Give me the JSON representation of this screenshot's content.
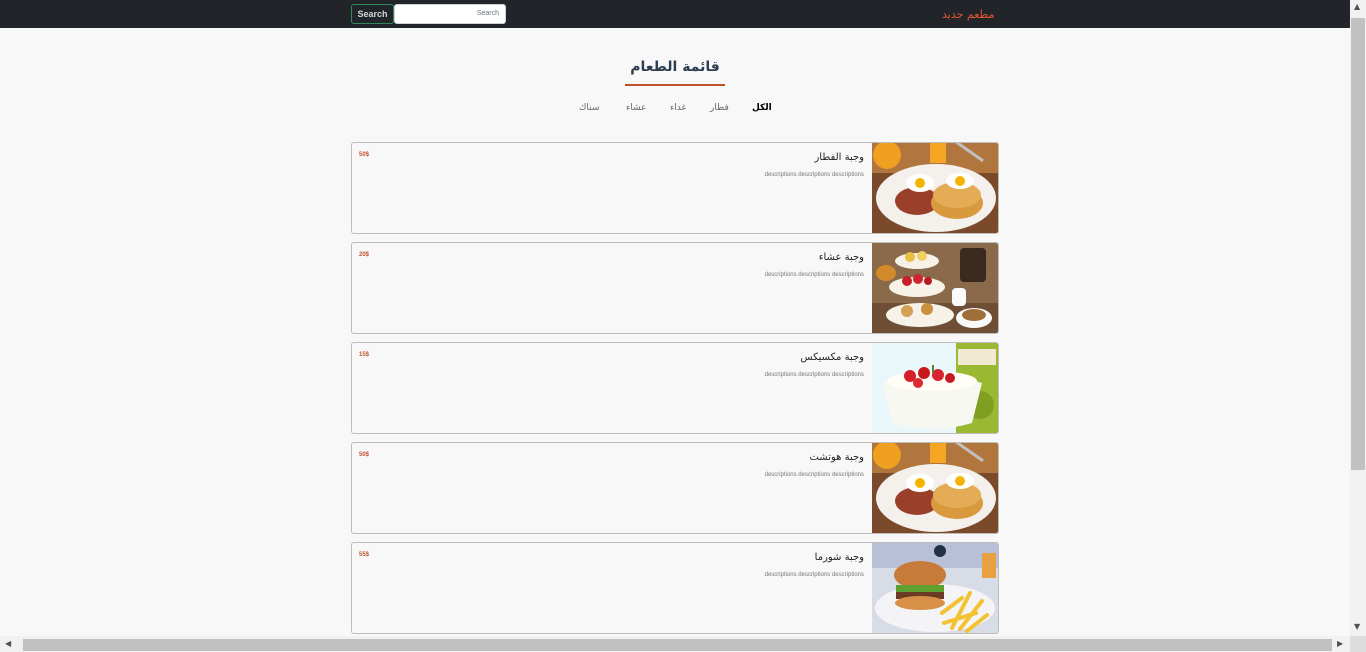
{
  "navbar": {
    "brand": "مطعم جديد",
    "search_button": "Search",
    "search_placeholder": "Search"
  },
  "menu": {
    "title": "قائمة الطعام",
    "tabs": [
      "الكل",
      "فطار",
      "غداء",
      "عشاء",
      "سناك"
    ],
    "active_tab": "الكل"
  },
  "items": [
    {
      "title": "وجبة الفطار",
      "description": "descriptions descriptions descriptions",
      "price": "50$",
      "image": "breakfast-plate-image"
    },
    {
      "title": "وجبة عشاء",
      "description": "descriptions descriptions descriptions",
      "price": "20$",
      "image": "afternoon-tea-image"
    },
    {
      "title": "وجبة مكسيكس",
      "description": "descriptions descriptions descriptions",
      "price": "15$",
      "image": "yogurt-strawberry-image"
    },
    {
      "title": "وجبة هوتشت",
      "description": "descriptions descriptions descriptions",
      "price": "50$",
      "image": "breakfast-plate-image"
    },
    {
      "title": "وجبة شورما",
      "description": "descriptions descriptions descriptions",
      "price": "55$",
      "image": "burger-fries-image"
    }
  ],
  "colors": {
    "navbar": "#212529",
    "accent": "#c0522b",
    "brand": "#e4572e"
  }
}
